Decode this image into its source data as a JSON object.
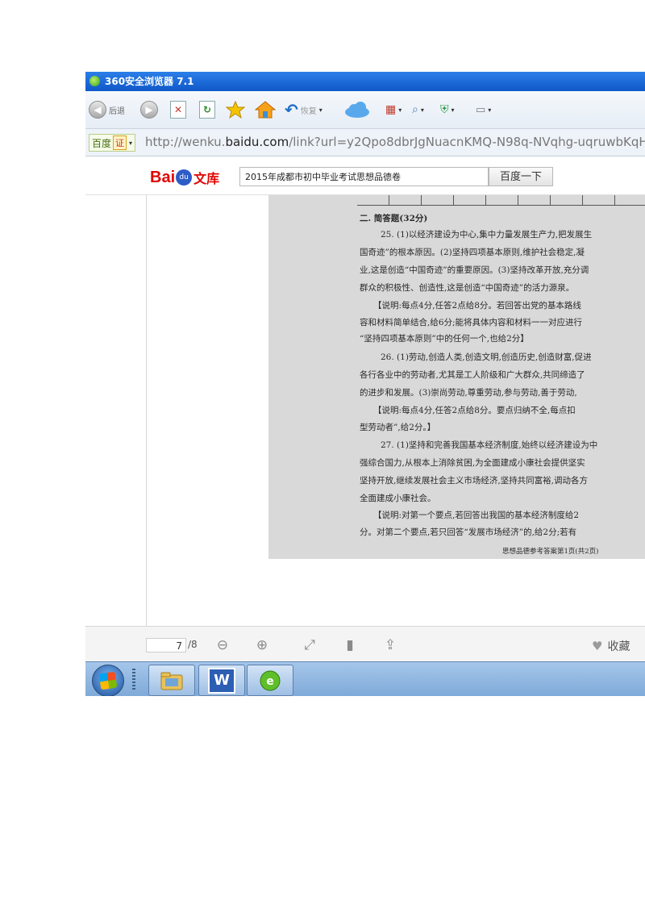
{
  "window": {
    "title": "360安全浏览器 7.1"
  },
  "toolbar": {
    "back_label": "后退",
    "restore_label": "恢复",
    "icons": [
      "back-icon",
      "forward-icon",
      "close-tab-icon",
      "refresh-icon",
      "star-icon",
      "home-icon",
      "undo-icon",
      "cloud-icon",
      "apps-icon",
      "search-icon",
      "shield-icon",
      "screenshot-icon"
    ]
  },
  "address": {
    "site_label": "百度",
    "cert_label": "证",
    "url_prefix": "http://wenku.",
    "url_domain": "baidu.com",
    "url_rest": "/link?url=y2Qpo8dbrJgNuacnKMQ-N98q-NVqhg-uqruwbKqH"
  },
  "baidu": {
    "logo_bai": "Bai",
    "logo_paw": "du",
    "logo_wenku": "文库",
    "search_value": "2015年成都市初中毕业考试思想品德卷",
    "search_button": "百度一下"
  },
  "document": {
    "section_title": "二. 简答题(32分)",
    "lines": [
      "25. (1)以经济建设为中心,集中力量发展生产力,把发展生",
      "国奇迹”的根本原因。(2)坚持四项基本原则,维护社会稳定,凝",
      "业,这是创造“中国奇迹”的重要原因。(3)坚持改革开放,充分调",
      "群众的积极性、创造性,这是创造“中国奇迹”的活力源泉。",
      "【说明:每点4分,任答2点给8分。若回答出党的基本路线",
      "容和材料简单结合,给6分;能将具体内容和材料一一对应进行",
      "“坚持四项基本原则”中的任何一个,也给2分】",
      "26. (1)劳动,创造人类,创造文明,创造历史,创造财富,促进",
      "各行各业中的劳动者,尤其是工人阶级和广大群众,共同缔造了",
      "的进步和发展。(3)崇尚劳动,尊重劳动,参与劳动,善于劳动,",
      "【说明:每点4分,任答2点给8分。要点归纳不全,每点扣",
      "型劳动者”,给2分。】",
      "27. (1)坚持和完善我国基本经济制度,始终以经济建设为中",
      "强综合国力,从根本上消除贫困,为全面建成小康社会提供坚实",
      "坚持开放,继续发展社会主义市场经济,坚持共同富裕,调动各方",
      "全面建成小康社会。",
      "【说明:对第一个要点,若回答出我国的基本经济制度给2",
      "分。对第二个要点,若只回答“发展市场经济”的,给2分;若有"
    ],
    "footer": "思想品德参考答案第1页(共2页)"
  },
  "reader": {
    "page_current": "7",
    "page_total": "/8",
    "favorite_label": "收藏"
  },
  "taskbar": {
    "apps": [
      "file-explorer",
      "wps-writer",
      "360-browser"
    ],
    "wps_letter": "W"
  }
}
